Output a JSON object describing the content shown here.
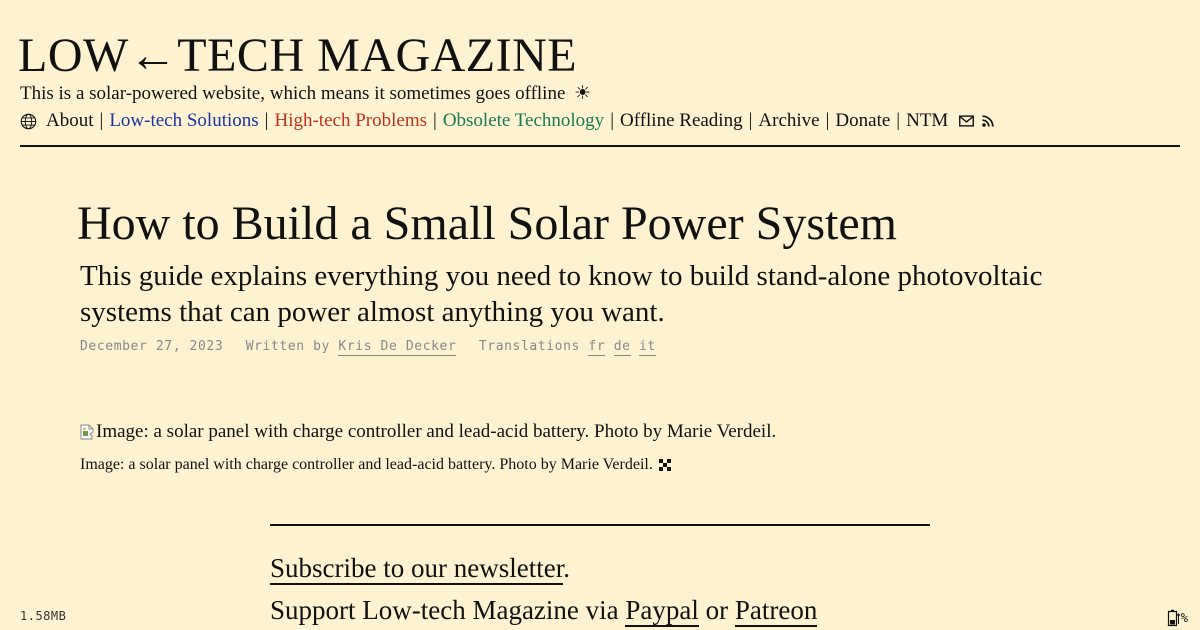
{
  "header": {
    "masthead": "LOW←TECH MAGAZINE",
    "tagline": "This is a solar-powered website, which means it sometimes goes offline",
    "sun": "☀",
    "nav": [
      {
        "label": "About"
      },
      {
        "label": "Low-tech Solutions"
      },
      {
        "label": "High-tech Problems"
      },
      {
        "label": "Obsolete Technology"
      },
      {
        "label": "Offline Reading"
      },
      {
        "label": "Archive"
      },
      {
        "label": "Donate"
      },
      {
        "label": "NTM"
      }
    ],
    "separator": "|",
    "icons": [
      "globe-icon",
      "mail-icon",
      "rss-icon"
    ]
  },
  "article": {
    "title": "How to Build a Small Solar Power System",
    "subtitle": "This guide explains everything you need to know to build stand-alone photovoltaic systems that can power almost anything you want.",
    "date": "December 27, 2023",
    "written_by_label": "Written by",
    "author": "Kris De Decker",
    "translations_label": "Translations",
    "translations": [
      "fr",
      "de",
      "it"
    ],
    "image_alt": "Image: a solar panel with charge controller and lead-acid battery. Photo by Marie Verdeil.",
    "image_caption": "Image: a solar panel with charge controller and lead-acid battery. Photo by Marie Verdeil."
  },
  "footer_cta": {
    "subscribe_link": "Subscribe to our newsletter",
    "subscribe_suffix": ".",
    "support_prefix": "Support Low-tech Magazine via",
    "paypal": "Paypal",
    "or": "or",
    "patreon": "Patreon"
  },
  "status": {
    "page_size": "1.58MB",
    "battery_percent_label": "%"
  },
  "colors": {
    "background": "#fdf3d0",
    "low_tech_solutions": "#1a33a0",
    "high_tech_problems": "#c0301e",
    "obsolete_technology": "#1b7a52"
  }
}
